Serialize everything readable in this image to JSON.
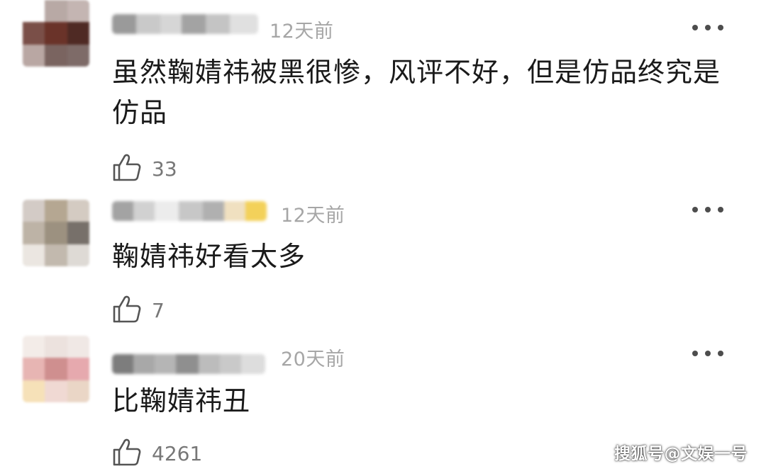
{
  "comments": [
    {
      "time": "12天前",
      "text": "虽然鞠婧祎被黑很惨，风评不好，但是仿品终究是仿品",
      "likes": "33"
    },
    {
      "time": "12天前",
      "text": "鞠婧祎好看太多",
      "likes": "7"
    },
    {
      "time": "20天前",
      "text": "比鞠婧祎丑",
      "likes": "4261"
    }
  ],
  "icons": {
    "more": "more-dots-icon",
    "like": "thumbs-up-icon"
  },
  "colors": {
    "time_text": "#a6a6a6",
    "comment_text": "#1a1a1a",
    "like_count": "#777777"
  },
  "watermark": "搜狐号@文娱一号"
}
